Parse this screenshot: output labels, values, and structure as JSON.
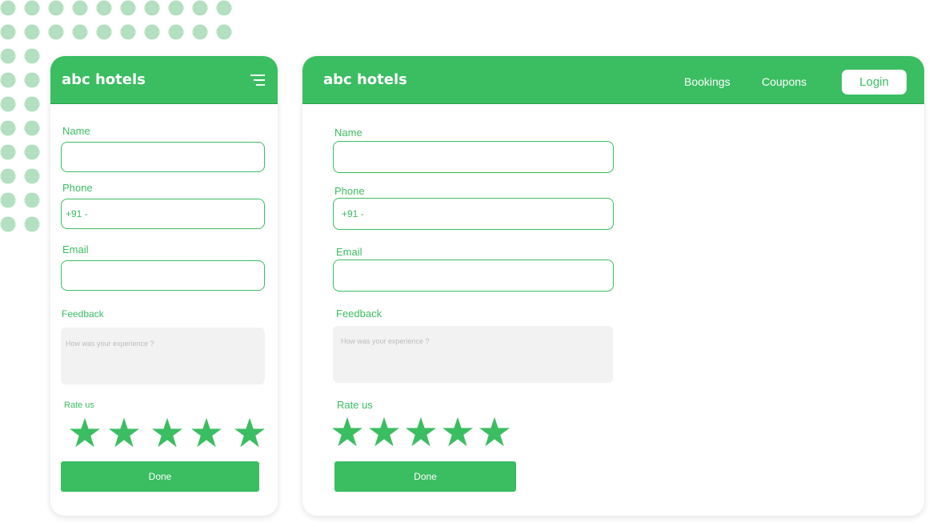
{
  "brand": {
    "name": "abc hotels"
  },
  "nav": {
    "bookings": "Bookings",
    "coupons": "Coupons",
    "login": "Login"
  },
  "form": {
    "name_label": "Name",
    "phone_label": "Phone",
    "phone_prefix": "+91 -",
    "email_label": "Email",
    "feedback_label": "Feedback",
    "feedback_placeholder": "How was your experience ?",
    "rate_label": "Rate us",
    "rating_max": 5,
    "done_label": "Done"
  },
  "colors": {
    "accent": "#3bbd62",
    "dots": "#b3e0c2",
    "textarea_bg": "#f2f2f2"
  },
  "icons": {
    "menu": "hamburger-menu-icon",
    "rating": "star-icon"
  }
}
